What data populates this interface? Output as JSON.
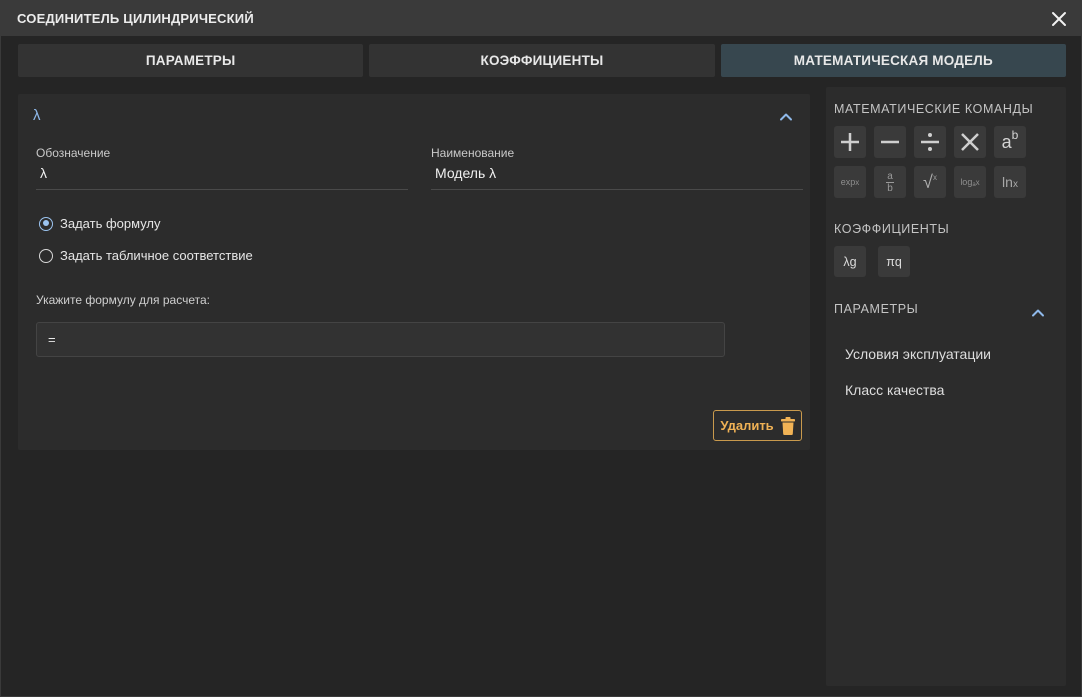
{
  "window": {
    "title": "СОЕДИНИТЕЛЬ ЦИЛИНДРИЧЕСКИЙ",
    "close_icon": "close-icon"
  },
  "tabs": [
    {
      "label": "ПАРАМЕТРЫ",
      "active": false
    },
    {
      "label": "КОЭФФИЦИЕНТЫ",
      "active": false
    },
    {
      "label": "МАТЕМАТИЧЕСКАЯ МОДЕЛЬ",
      "active": true
    }
  ],
  "main": {
    "section_title": "λ",
    "collapse_icon": "chevron-up-icon",
    "designation": {
      "label": "Обозначение",
      "value": "λ"
    },
    "name": {
      "label": "Наименование",
      "value": "Модель λ"
    },
    "radio_options": [
      {
        "label": "Задать формулу",
        "checked": true
      },
      {
        "label": "Задать табличное соответствие",
        "checked": false
      }
    ],
    "formula_label": "Укажите формулу для расчета:",
    "formula_value": "=",
    "delete_label": "Удалить",
    "delete_icon": "trash-icon"
  },
  "side": {
    "math_title": "МАТЕМАТИЧЕСКИЕ КОМАНДЫ",
    "math_commands": [
      {
        "name": "plus-icon"
      },
      {
        "name": "minus-icon"
      },
      {
        "name": "divide-icon"
      },
      {
        "name": "multiply-icon"
      },
      {
        "name": "power-icon",
        "base": "a",
        "exp": "b"
      },
      {
        "name": "exp-icon",
        "text": "exp",
        "sub": "x"
      },
      {
        "name": "fraction-icon",
        "num": "a",
        "den": "b"
      },
      {
        "name": "sqrt-icon",
        "arg": "x"
      },
      {
        "name": "log-icon",
        "text": "log",
        "sub": "a",
        "arg": "x"
      },
      {
        "name": "ln-icon",
        "text": "ln",
        "arg": "x"
      }
    ],
    "coef_title": "КОЭФФИЦИЕНТЫ",
    "coefficients": [
      "λg",
      "πq"
    ],
    "params_title": "ПАРАМЕТРЫ",
    "params": [
      "Условия эксплуатации",
      "Класс качества"
    ]
  },
  "colors": {
    "accent": "#8fb9ea",
    "active_tab": "#37474f",
    "delete": "#f0b255"
  }
}
